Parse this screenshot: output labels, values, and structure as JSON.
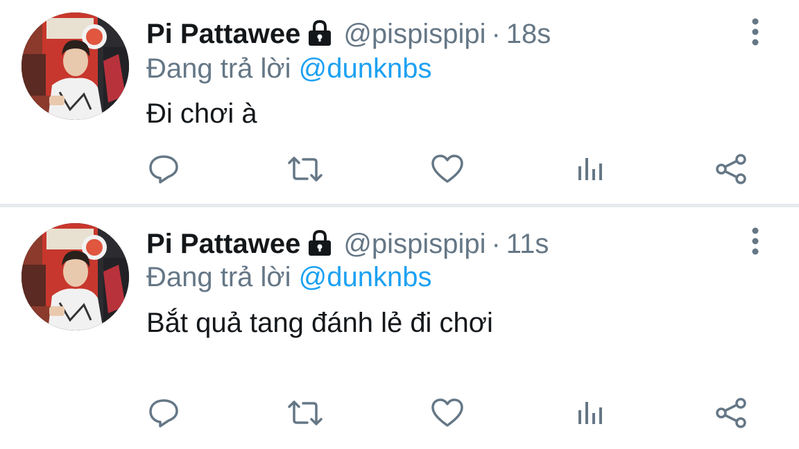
{
  "colors": {
    "text_primary": "#14171a",
    "text_secondary": "#657786",
    "mention": "#1da1f2",
    "divider": "#e7eaed",
    "icon": "#657786"
  },
  "tweets": [
    {
      "display_name": "Pi Pattawee",
      "handle": "@pispispipi",
      "separator": "·",
      "time": "18s",
      "reply_prefix": "Đang trả lời",
      "reply_to": "@dunknbs",
      "text": "Đi chơi à",
      "icons": [
        "lock-icon",
        "more-vertical-icon",
        "reply-icon",
        "retweet-icon",
        "like-icon",
        "analytics-icon",
        "share-icon"
      ]
    },
    {
      "display_name": "Pi Pattawee",
      "handle": "@pispispipi",
      "separator": "·",
      "time": "11s",
      "reply_prefix": "Đang trả lời",
      "reply_to": "@dunknbs",
      "text": "Bắt quả tang đánh lẻ đi chơi",
      "icons": [
        "lock-icon",
        "more-vertical-icon",
        "reply-icon",
        "retweet-icon",
        "like-icon",
        "analytics-icon",
        "share-icon"
      ]
    }
  ]
}
